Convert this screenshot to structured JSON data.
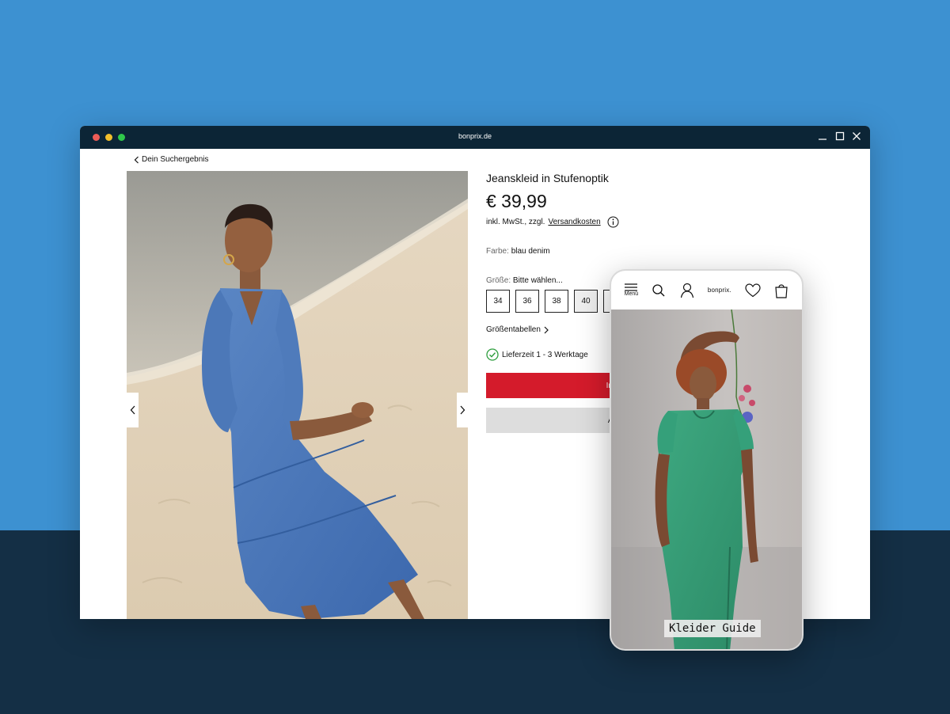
{
  "browser": {
    "url": "bonprix.de",
    "controls": [
      "minimize-icon",
      "maximize-icon",
      "close-icon"
    ]
  },
  "breadcrumb": {
    "label": "Dein Suchergebnis",
    "icon": "chevron-left-icon"
  },
  "product": {
    "title": "Jeanskleid in Stufenoptik",
    "price": "€ 39,99",
    "tax_prefix": "inkl. MwSt., zzgl.",
    "shipping_link": "Versandkosten",
    "color_label": "Farbe:",
    "color_value": "blau denim",
    "size_label": "Größe:",
    "size_value": "Bitte wählen...",
    "sizes": [
      "34",
      "36",
      "38",
      "40"
    ],
    "size_table_link": "Größentabellen",
    "delivery": "Lieferzeit 1 - 3 Werktage",
    "add_to_cart": "In d",
    "secondary_button": "Au"
  },
  "phone": {
    "menu_label": "Menü",
    "brand": "bonprix.",
    "icons": [
      "menu-icon",
      "search-icon",
      "account-icon",
      "wishlist-icon",
      "bag-icon"
    ],
    "guide_label": "Kleider Guide"
  },
  "colors": {
    "background_top": "#3d91d1",
    "background_bottom": "#142f45",
    "titlebar": "#0c2536",
    "cta_red": "#d41b2b",
    "cta_grey": "#dddddd",
    "success_green": "#2e9e3e"
  }
}
